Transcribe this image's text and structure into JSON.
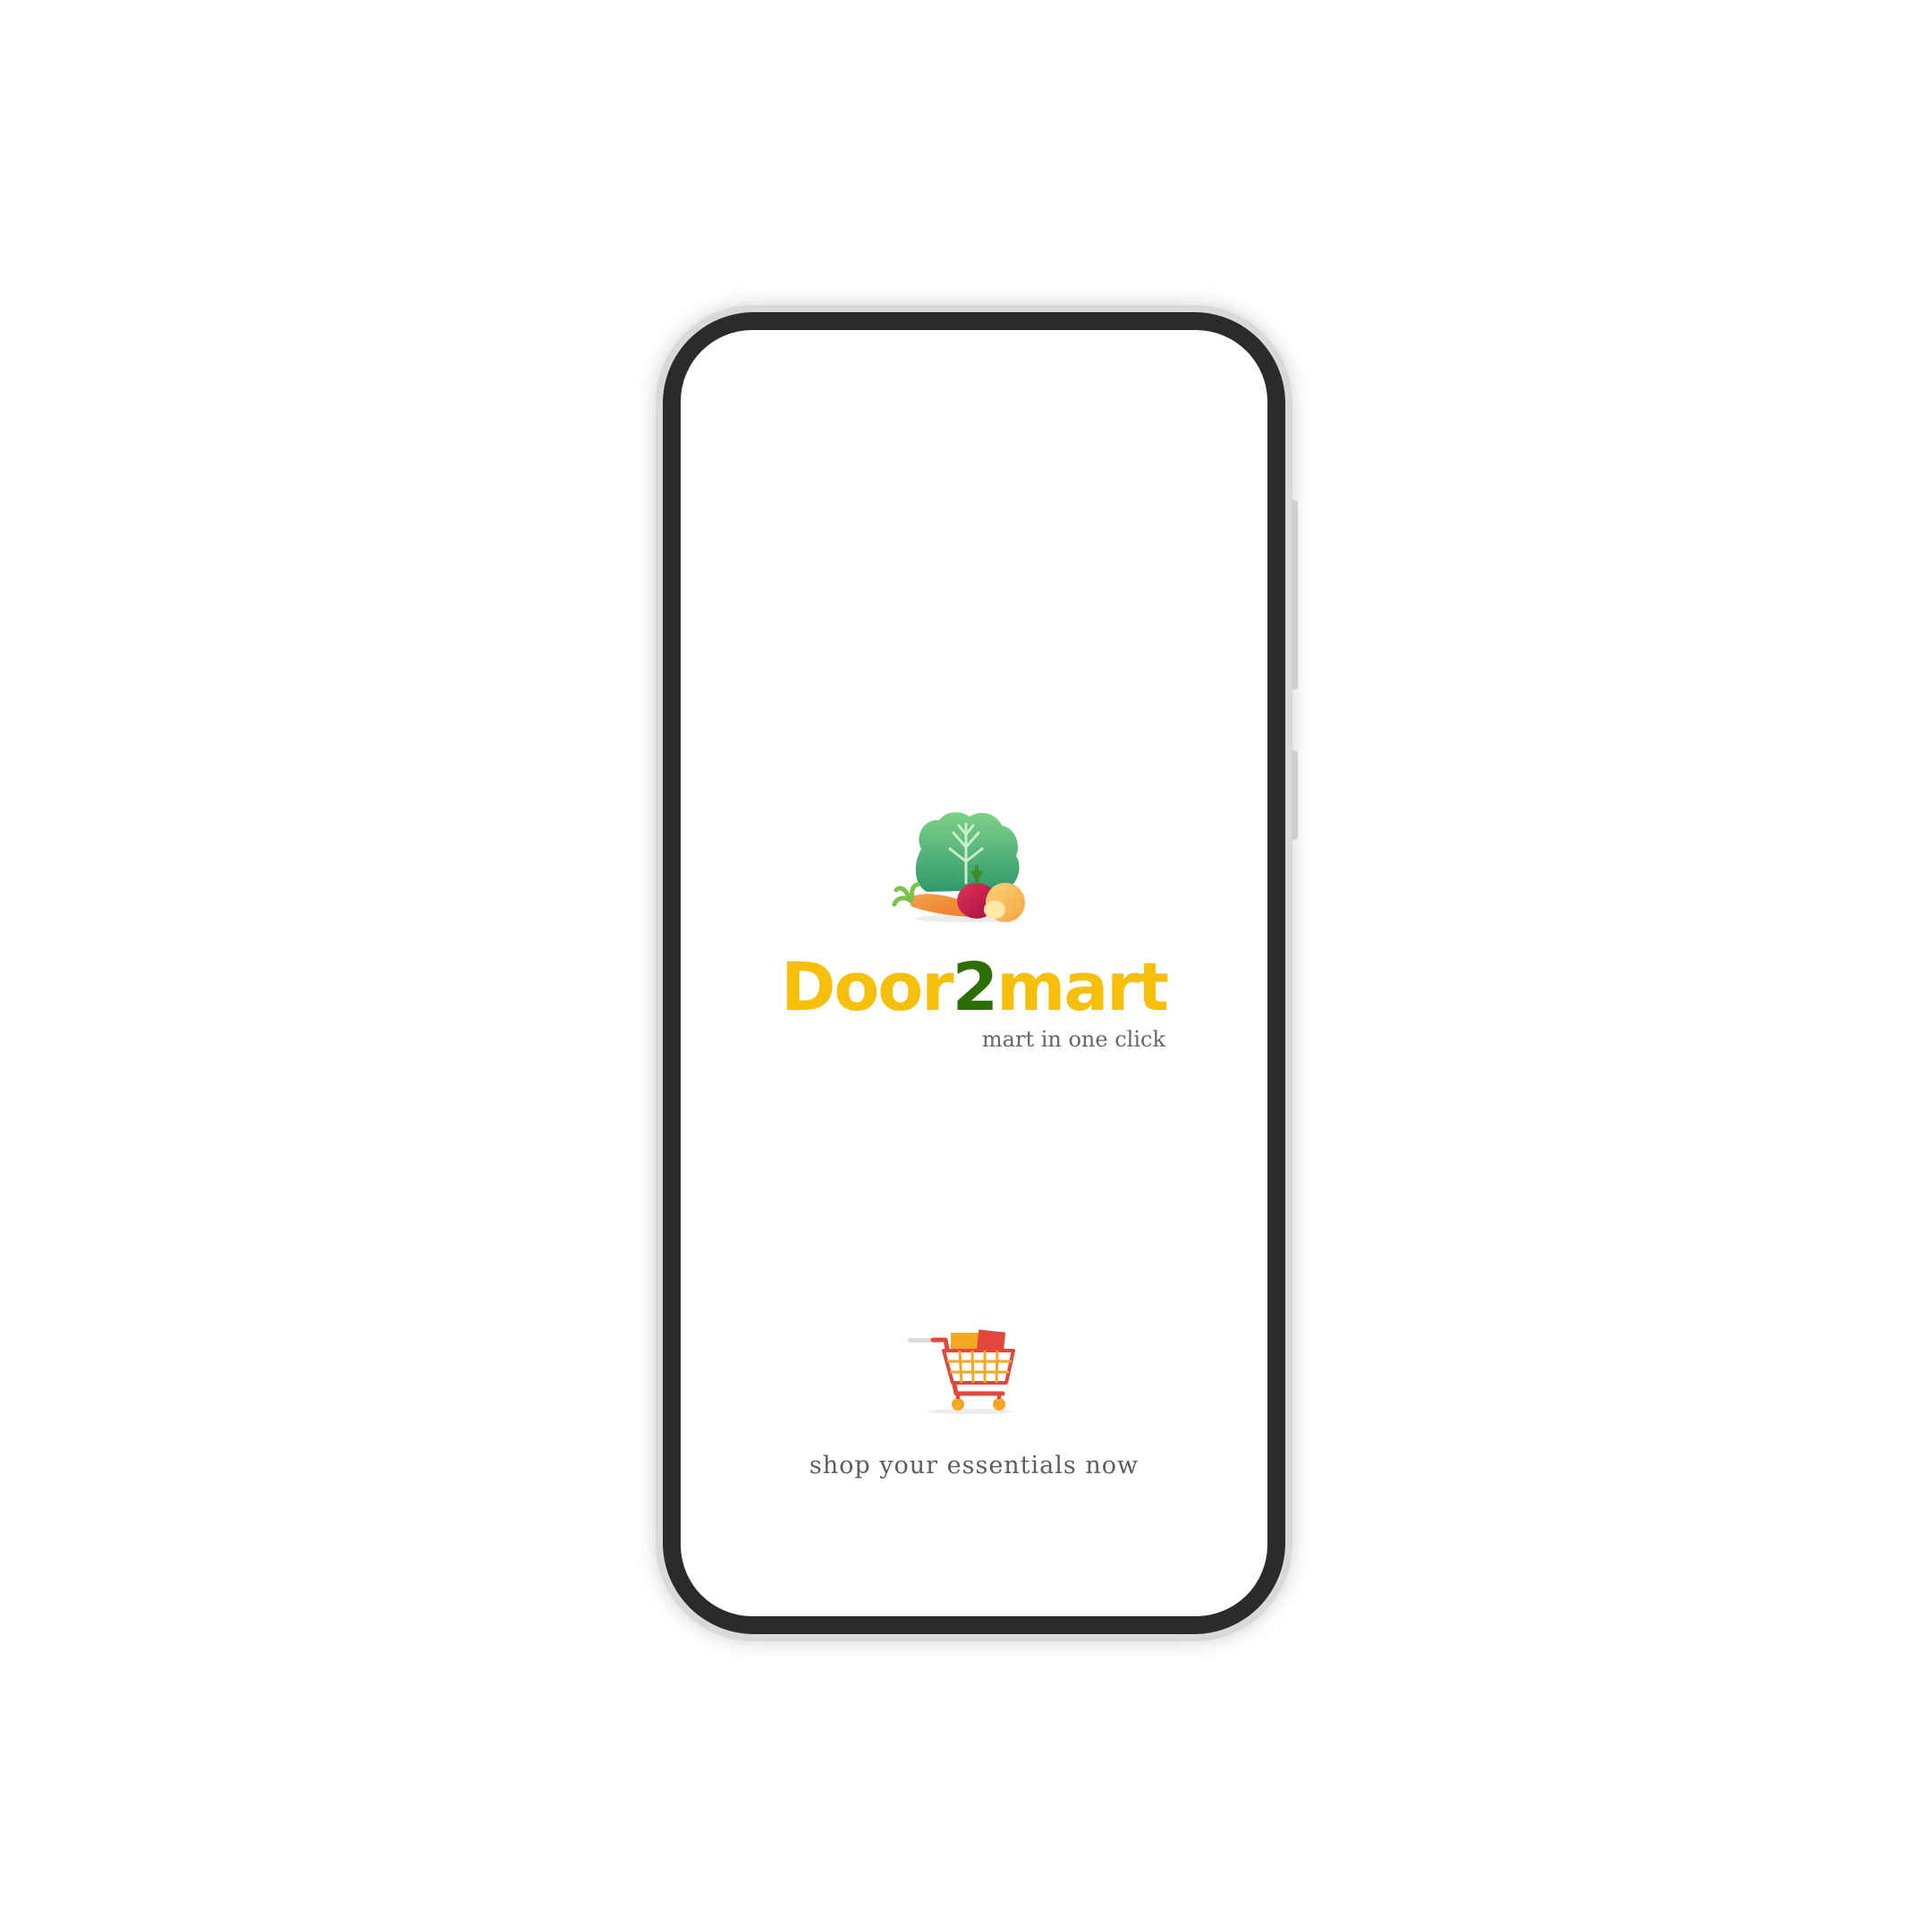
{
  "app": {
    "brand_part1": "Door",
    "brand_part2": "2",
    "brand_part3": "mart",
    "tagline": "mart in one click",
    "footer_text": "shop your essentials now"
  },
  "icons": {
    "logo": "vegetables-icon",
    "cart": "shopping-cart-icon"
  },
  "colors": {
    "brand_yellow": "#f6bf0b",
    "brand_green": "#2f6e05",
    "text_gray": "#666666",
    "phone_bezel": "#2b2b2b",
    "screen_bg": "#ffffff"
  }
}
